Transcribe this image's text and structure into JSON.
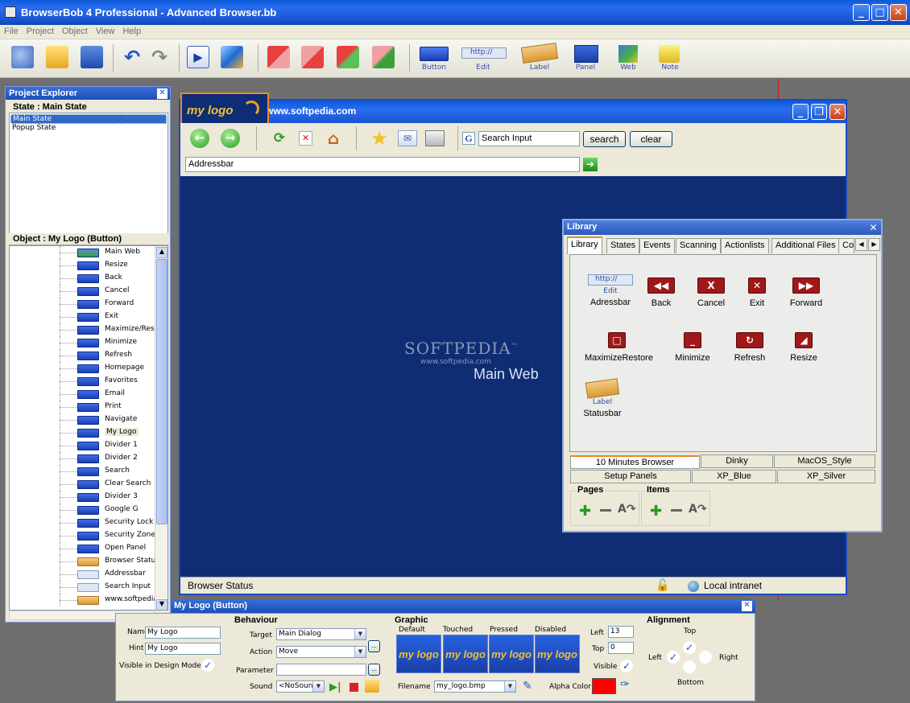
{
  "app": {
    "title": "BrowserBob 4 Professional - Advanced Browser.bb"
  },
  "menu": [
    "File",
    "Project",
    "Object",
    "View",
    "Help"
  ],
  "toolbar": {
    "labels": {
      "button": "Button",
      "edit": "Edit",
      "edit_value": "http://",
      "label": "Label",
      "panel": "Panel",
      "web": "Web",
      "note": "Note"
    }
  },
  "explorer": {
    "title": "Project Explorer",
    "state_header": "State : Main State",
    "states": [
      "Main State",
      "Popup State"
    ],
    "object_header": "Object : My Logo (Button)",
    "objects": [
      {
        "name": "Main Web",
        "icon": "web"
      },
      {
        "name": "Resize",
        "icon": "button"
      },
      {
        "name": "Back",
        "icon": "button"
      },
      {
        "name": "Cancel",
        "icon": "button"
      },
      {
        "name": "Forward",
        "icon": "button"
      },
      {
        "name": "Exit",
        "icon": "button"
      },
      {
        "name": "Maximize/Restore",
        "icon": "button"
      },
      {
        "name": "Minimize",
        "icon": "button"
      },
      {
        "name": "Refresh",
        "icon": "button"
      },
      {
        "name": "Homepage",
        "icon": "button"
      },
      {
        "name": "Favorites",
        "icon": "button"
      },
      {
        "name": "Email",
        "icon": "button"
      },
      {
        "name": "Print",
        "icon": "button"
      },
      {
        "name": "Navigate",
        "icon": "button"
      },
      {
        "name": "My Logo",
        "icon": "button"
      },
      {
        "name": "Divider 1",
        "icon": "button"
      },
      {
        "name": "Divider 2",
        "icon": "button"
      },
      {
        "name": "Search",
        "icon": "button"
      },
      {
        "name": "Clear Search",
        "icon": "button"
      },
      {
        "name": "Divider 3",
        "icon": "button"
      },
      {
        "name": "Google G",
        "icon": "button"
      },
      {
        "name": "Security Lock",
        "icon": "button"
      },
      {
        "name": "Security Zone",
        "icon": "button"
      },
      {
        "name": "Open Panel",
        "icon": "button"
      },
      {
        "name": "Browser Status",
        "icon": "label"
      },
      {
        "name": "Addressbar",
        "icon": "edit"
      },
      {
        "name": "Search Input",
        "icon": "edit"
      },
      {
        "name": "www.softpedia.co",
        "icon": "label"
      }
    ]
  },
  "browser": {
    "logo_text": "my logo",
    "url_title": "www.softpedia.com",
    "search_placeholder": "Search Input",
    "search_button": "search",
    "clear_button": "clear",
    "addressbar": "Addressbar",
    "main_web": "Main Web",
    "watermark": "SOFTPEDIA",
    "watermark_tm": "™",
    "watermark_url": "www.softpedia.com",
    "status": "Browser Status",
    "zone": "Local intranet",
    "google_letter": "G"
  },
  "library": {
    "title": "Library",
    "tabs": [
      "Library",
      "States",
      "Events",
      "Scanning",
      "Actionlists",
      "Additional Files",
      "Co"
    ],
    "edit_box": "http://",
    "edit_sub": "Edit",
    "label_sub": "Label",
    "items": [
      {
        "name": "Adressbar"
      },
      {
        "name": "Back",
        "glyph": "◀◀"
      },
      {
        "name": "Cancel",
        "glyph": "X"
      },
      {
        "name": "Exit",
        "glyph": "✕"
      },
      {
        "name": "Forward",
        "glyph": "▶▶"
      },
      {
        "name": "MaximizeRestore",
        "glyph": "□"
      },
      {
        "name": "Minimize",
        "glyph": "_"
      },
      {
        "name": "Refresh",
        "glyph": "↻"
      },
      {
        "name": "Resize",
        "glyph": "◢"
      },
      {
        "name": "Statusbar"
      }
    ],
    "skins_row1": [
      "10 Minutes Browser",
      "Dinky",
      "MacOS_Style"
    ],
    "skins_row2": [
      "Setup Panels",
      "XP_Blue",
      "XP_Silver"
    ],
    "pages_label": "Pages",
    "items_label": "Items"
  },
  "props": {
    "title": "My Logo (Button)",
    "name_label": "Name",
    "name_value": "My Logo",
    "hint_label": "Hint",
    "hint_value": "My Logo",
    "visible_design_label": "Visible in Design Mode",
    "behaviour": "Behaviour",
    "target_label": "Target",
    "target_value": "Main Dialog",
    "action_label": "Action",
    "action_value": "Move",
    "parameter_label": "Parameter",
    "parameter_value": "",
    "sound_label": "Sound",
    "sound_value": "<NoSound>",
    "graphic": "Graphic",
    "states": [
      "Default",
      "Touched",
      "Pressed",
      "Disabled"
    ],
    "filename_label": "Filename",
    "filename_value": "my_logo.bmp",
    "left_label": "Left",
    "left_value": "13",
    "top_label": "Top",
    "top_value": "0",
    "visible_label": "Visible",
    "alpha_label": "Alpha Color",
    "alpha_color": "#ff0000",
    "alignment": "Alignment",
    "align_top": "Top",
    "align_left": "Left",
    "align_right": "Right",
    "align_bottom": "Bottom",
    "ellipsis": "..."
  }
}
